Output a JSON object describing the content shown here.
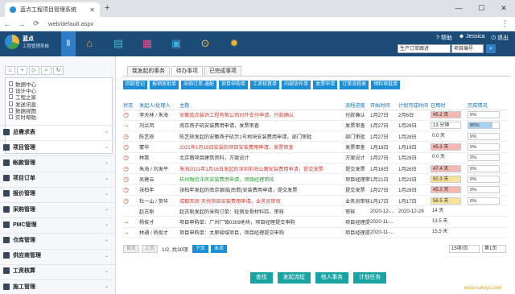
{
  "browser": {
    "tab_title": "蓝点工程项目管理系统",
    "url": "web/default.aspx",
    "new_tab": "+",
    "win_min": "—",
    "win_max": "☐",
    "win_close": "✕"
  },
  "header": {
    "logo_title": "蓝点",
    "logo_subtitle": "工程管理系统",
    "help": "帮助",
    "user": "Jessica",
    "exit": "退出",
    "filter_label": "生产订单跟进",
    "filter_value": "项目编号",
    "icons": [
      "home-icon",
      "id-card-icon",
      "grid-icon",
      "window-icon",
      "search-icon",
      "gear-icon"
    ]
  },
  "sidebar": {
    "tree": [
      "数据中心",
      "设计中心",
      "工程之家",
      "发送讯息",
      "数据视图",
      "实时帮助"
    ],
    "groups": [
      "总需求表",
      "项目管理",
      "帐款管理",
      "项目订单",
      "报价管理",
      "采购管理",
      "PMC管理",
      "仓库管理",
      "供应商管理",
      "工资核算",
      "施工管理"
    ]
  },
  "main": {
    "tabs": [
      "我发起的事务",
      "待办事项",
      "已完成事项"
    ],
    "active_tab": 1,
    "buttons": [
      "回款登记",
      "报销审批单",
      "采购订单-通配",
      "项目申购单",
      "工资核算单",
      "内部协作单",
      "发票申请",
      "订单流程表",
      "领料审批单"
    ],
    "columns": [
      "状态",
      "发起人/处理人",
      "主题",
      "流程进度",
      "开始时间",
      "计划完成时间",
      "已用时",
      "完成情况"
    ],
    "rows": [
      {
        "status": "clock",
        "person": "李天林 / 朱海",
        "subject": "安徽蓝点装饰工程有限公司对外支付申请，付款确认",
        "progress": "付款确认",
        "start": "1月27日",
        "plan": "2月6日",
        "used": "45.2 天",
        "used_style": "pink",
        "done": "0%",
        "done_pct": 0,
        "color": "red"
      },
      {
        "status": "arrow",
        "person": "刘兰凤",
        "subject": "南京燕子矶安装费用申请，发票审查",
        "progress": "发票审查",
        "start": "1月27日",
        "plan": "1月28日",
        "used": "13 分钟",
        "used_style": "outline",
        "done": "80%",
        "done_pct": 80,
        "color": "blue"
      },
      {
        "status": "clock",
        "person": "陈艺琼",
        "subject": "陈艺琼发起的安徽燕子矶示1号地块安装费用申请，部门审批",
        "progress": "部门审批",
        "start": "1月27日",
        "plan": "1月28日",
        "used": "0.0 天",
        "used_style": "plain",
        "done": "0%",
        "done_pct": 0,
        "color": "blue"
      },
      {
        "status": "clock",
        "person": "蒙华",
        "subject": "2021年1月18日安装的项目安装费用申请，发票审查",
        "progress": "发票审查",
        "start": "1月18日",
        "plan": "1月19日",
        "used": "45.3 天",
        "used_style": "pink",
        "done": "0%",
        "done_pct": 0,
        "color": "red"
      },
      {
        "status": "clock",
        "person": "林惠",
        "subject": "北京路项目建筑资料，方案设计",
        "progress": "方案设计",
        "start": "1月27日",
        "plan": "1月28日",
        "used": "0.0 天",
        "used_style": "plain",
        "done": "0%",
        "done_pct": 0,
        "color": "blue"
      },
      {
        "status": "clock",
        "person": "朱海 / 刘发平",
        "subject": "朱海2021年1月16日发起的深圳前海公寓安装费用申请，提交发票",
        "progress": "提交发票",
        "start": "1月16日",
        "plan": "1月26日",
        "used": "47.4 天",
        "used_style": "pink",
        "done": "0%",
        "done_pct": 0,
        "color": "red"
      },
      {
        "status": "clock",
        "person": "吴建云",
        "subject": "杭州融信洋房安装费用申请，项目经理审核",
        "progress": "项目经理审核",
        "start": "1月21日",
        "plan": "1月23日",
        "used": "50.3 天",
        "used_style": "yellow",
        "done": "0%",
        "done_pct": 0,
        "color": "green"
      },
      {
        "status": "clock",
        "person": "张柏年",
        "subject": "张柏年发起的南京银城(南翡)安装费用申请，提交发票",
        "progress": "提交发票",
        "start": "1月27日",
        "plan": "1月28日",
        "used": "45.2 天",
        "used_style": "pink",
        "done": "0%",
        "done_pct": 0,
        "color": "blue"
      },
      {
        "status": "clock",
        "person": "杜一山 / 贺华",
        "subject": "成都天颂·天悦项目安装费用申请，业务员审核",
        "progress": "业务员审核",
        "start": "1月17日",
        "plan": "1月17日",
        "used": "56.5 天",
        "used_style": "yellow",
        "done": "0%",
        "done_pct": 0,
        "color": "red"
      },
      {
        "status": "none",
        "person": "赵古刚",
        "subject": "赵古刚发起的采购订单：轻钢龙骨材料匹，审核",
        "progress": "审核",
        "start": "2020-12-...",
        "plan": "2020-12-29",
        "used": "14 天",
        "used_style": "plain",
        "done": "",
        "done_pct": -1,
        "color": "blue"
      },
      {
        "status": "arrow",
        "person": "杨俊才",
        "subject": "项目申购单：广州厂镇0309地块，项目经理提交申购",
        "progress": "项目经理提交申购",
        "start": "2020-11-...",
        "plan": "",
        "used": "13.5 天",
        "used_style": "plain",
        "done": "",
        "done_pct": -1,
        "color": "blue"
      },
      {
        "status": "arrow",
        "person": "林通 / 杨俊才",
        "subject": "项目申购单：太原峻域项目，项目经理提交申购",
        "progress": "项目经理提交申购",
        "start": "2020-11-...",
        "plan": "",
        "used": "15.5 天",
        "used_style": "plain",
        "done": "",
        "done_pct": -1,
        "color": "blue"
      }
    ],
    "pager": {
      "first": "首页",
      "prev": "上页",
      "info": "1/2, 共30项",
      "next": "下页",
      "last": "末页",
      "per_page": "15项/页",
      "page_sel": "第1页"
    },
    "actions": [
      "查找",
      "发起流程",
      "他人事务",
      "计划任务"
    ]
  },
  "watermark": {
    "text": "锐客网",
    "url": "www.ruikeyz.com"
  }
}
